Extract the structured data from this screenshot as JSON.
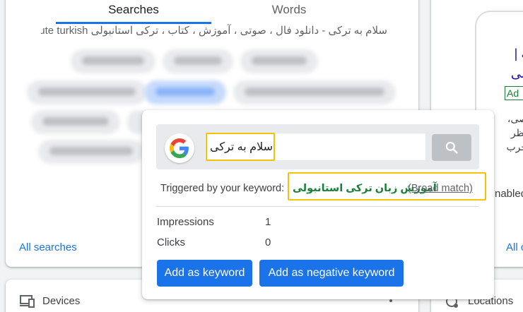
{
  "tabs": {
    "searches": "Searches",
    "words": "Words"
  },
  "query_header": "سلام به ترکی - دانلود فال ، صوتی ، آموزش ، کتاب ، ترکی استانبولی one minute turkish",
  "left_card": {
    "all_link": "All searches"
  },
  "ad_preview": {
    "title": "نه | ولی",
    "badge": "Ad",
    "description": "صی، نظر جرب",
    "status_fragment": "nabled",
    "all_link": "All c"
  },
  "devices": {
    "label": "Devices"
  },
  "locations": {
    "label": "Locations"
  },
  "popup": {
    "search_query": "سلام به ترکی",
    "trigger_label": "Triggered by your keyword:",
    "keyword": "آموزش زبان ترکی استانبولی",
    "match_type": "(Broad match)",
    "stats": [
      {
        "label": "Impressions",
        "value": "1"
      },
      {
        "label": "Clicks",
        "value": "0"
      }
    ],
    "add_keyword_button": "Add as keyword",
    "add_negative_button": "Add as negative keyword",
    "icons": {
      "logo": "google-g-logo",
      "search": "search-icon"
    }
  },
  "colors": {
    "accent": "#1a73e8",
    "keyword_green": "#188038",
    "highlight": "#f4c20d"
  }
}
